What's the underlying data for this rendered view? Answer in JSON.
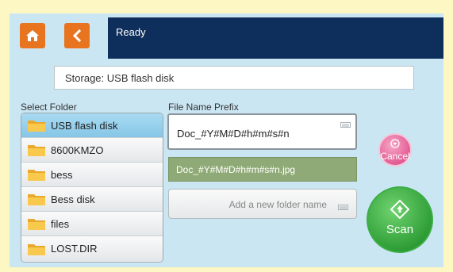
{
  "status": {
    "text": "Ready"
  },
  "storage": {
    "text": "Storage: USB flash disk"
  },
  "folders": {
    "label": "Select Folder",
    "items": [
      "USB flash disk",
      "8600KMZO",
      "bess",
      "Bess disk",
      "files",
      "LOST.DIR"
    ],
    "selected_index": 0
  },
  "file_name": {
    "label": "File Name Prefix",
    "prefix_value": "Doc_#Y#M#D#h#m#s#n",
    "preview": "Doc_#Y#M#D#h#m#s#n.jpg",
    "new_folder_placeholder": "Add a new folder name"
  },
  "buttons": {
    "cancel": "Cancel",
    "scan": "Scan"
  },
  "icons": {
    "home": "home-icon",
    "back": "chevron-left-icon",
    "folder": "folder-icon",
    "keyboard": "keyboard-icon",
    "cancel": "chevron-down-circle-icon",
    "scan": "diamond-arrow-icon"
  },
  "colors": {
    "background": "#fdf7c3",
    "panel": "#cbe6f3",
    "status_bar": "#0e2e5b",
    "nav_button": "#e8741f",
    "preview": "#8faa76",
    "cancel": "#e25c94",
    "scan": "#2f9e36"
  }
}
